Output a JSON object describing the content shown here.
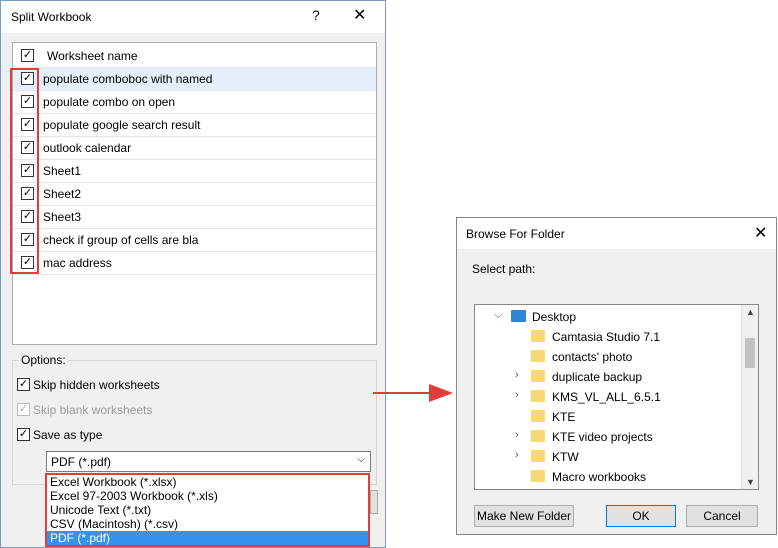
{
  "split_dialog": {
    "title": "Split Workbook",
    "help_glyph": "?",
    "close_glyph": "✕",
    "list_header": "Worksheet name",
    "sheets": [
      {
        "name": "populate comboboc with named",
        "checked": true
      },
      {
        "name": "populate combo on open",
        "checked": true
      },
      {
        "name": "populate google search result",
        "checked": true
      },
      {
        "name": "outlook calendar",
        "checked": true
      },
      {
        "name": "Sheet1",
        "checked": true
      },
      {
        "name": "Sheet2",
        "checked": true
      },
      {
        "name": "Sheet3",
        "checked": true
      },
      {
        "name": "check if group of cells are bla",
        "checked": true
      },
      {
        "name": "mac address",
        "checked": true
      }
    ],
    "options_label": "Options:",
    "skip_hidden": "Skip hidden worksheets",
    "skip_blank": "Skip blank worksheets",
    "save_as_type": "Save as type",
    "selected_type": "PDF (*.pdf)",
    "type_options": [
      "Excel Workbook (*.xlsx)",
      "Excel 97-2003 Workbook (*.xls)",
      "Unicode Text (*.txt)",
      "CSV (Macintosh) (*.csv)",
      "PDF (*.pdf)"
    ],
    "check_glyph": "✓"
  },
  "browse_dialog": {
    "title": "Browse For Folder",
    "close_glyph": "✕",
    "select_path_label": "Select path:",
    "tree": [
      {
        "name": "Desktop",
        "expander": "⌵",
        "icon": "desktop-folder-icon"
      },
      {
        "name": "Camtasia Studio 7.1",
        "expander": "",
        "icon": "folder-icon"
      },
      {
        "name": "contacts' photo",
        "expander": "",
        "icon": "folder-icon"
      },
      {
        "name": "duplicate backup",
        "expander": "›",
        "icon": "folder-icon"
      },
      {
        "name": "KMS_VL_ALL_6.5.1",
        "expander": "›",
        "icon": "folder-icon"
      },
      {
        "name": "KTE",
        "expander": "",
        "icon": "folder-icon"
      },
      {
        "name": "KTE video projects",
        "expander": "›",
        "icon": "folder-icon"
      },
      {
        "name": "KTW",
        "expander": "›",
        "icon": "folder-icon"
      },
      {
        "name": "Macro workbooks",
        "expander": "",
        "icon": "folder-icon"
      }
    ],
    "make_new_folder": "Make New Folder",
    "ok": "OK",
    "cancel": "Cancel"
  },
  "colors": {
    "highlight_red": "#e23c3c",
    "selection_blue": "#3394f0",
    "folder_yellow": "#f8d775",
    "desktop_blue": "#2b86d8"
  }
}
